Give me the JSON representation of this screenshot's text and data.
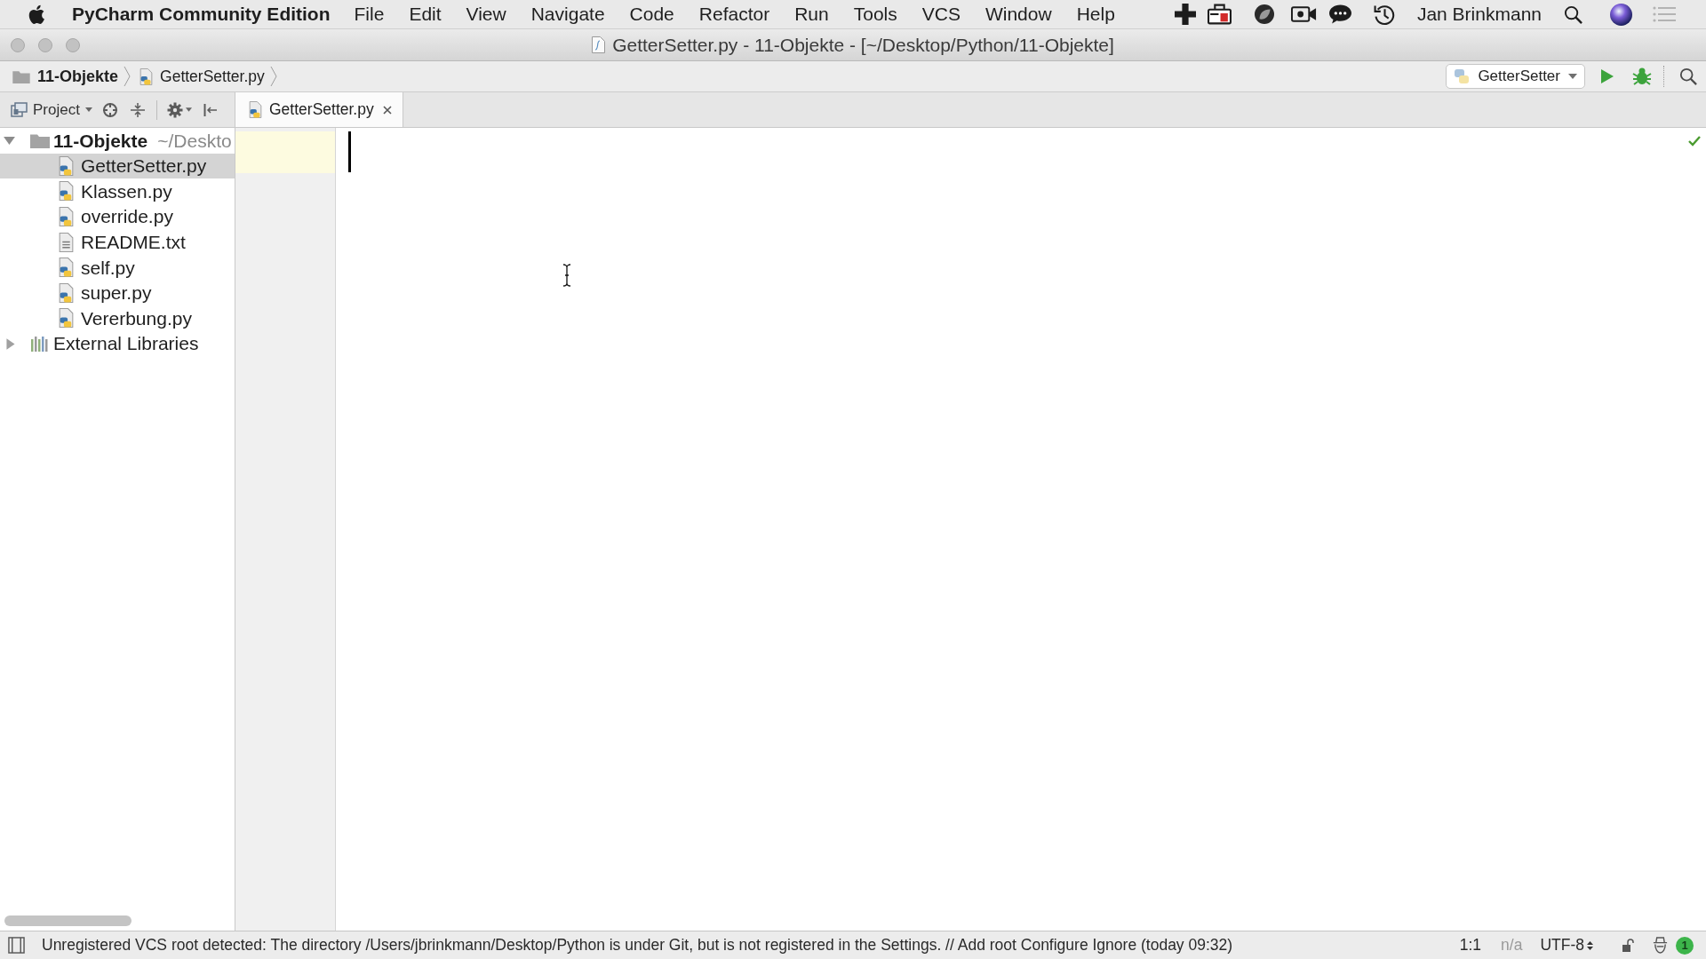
{
  "menu_bar": {
    "app_name": "PyCharm Community Edition",
    "menus": [
      "File",
      "Edit",
      "View",
      "Navigate",
      "Code",
      "Refactor",
      "Run",
      "Tools",
      "VCS",
      "Window",
      "Help"
    ],
    "user_name": "Jan Brinkmann"
  },
  "window": {
    "title": "GetterSetter.py - 11-Objekte - [~/Desktop/Python/11-Objekte]"
  },
  "navigation_bar": {
    "breadcrumbs": [
      {
        "label": "11-Objekte",
        "kind": "folder"
      },
      {
        "label": "GetterSetter.py",
        "kind": "python"
      }
    ],
    "run_configuration": "GetterSetter"
  },
  "project_panel": {
    "view_mode": "Project",
    "tree": [
      {
        "label": "11-Objekte",
        "path": "~/Deskto",
        "kind": "folder",
        "expanded": true,
        "selected": false,
        "children": [
          {
            "label": "GetterSetter.py",
            "kind": "python",
            "selected": true
          },
          {
            "label": "Klassen.py",
            "kind": "python",
            "selected": false
          },
          {
            "label": "override.py",
            "kind": "python",
            "selected": false
          },
          {
            "label": "README.txt",
            "kind": "text",
            "selected": false
          },
          {
            "label": "self.py",
            "kind": "python",
            "selected": false
          },
          {
            "label": "super.py",
            "kind": "python",
            "selected": false
          },
          {
            "label": "Vererbung.py",
            "kind": "python",
            "selected": false
          }
        ]
      },
      {
        "label": "External Libraries",
        "kind": "library",
        "expanded": false,
        "selected": false
      }
    ]
  },
  "editor": {
    "tabs": [
      {
        "label": "GetterSetter.py",
        "kind": "python",
        "selected": true
      }
    ]
  },
  "status_bar": {
    "message": "Unregistered VCS root detected: The directory /Users/jbrinkmann/Desktop/Python is under Git, but is not registered in the Settings. // Add root Configure Ignore (today 09:32)",
    "caret_position": "1:1",
    "line_separator": "n/a",
    "encoding": "UTF-8",
    "notification_count": "1"
  }
}
